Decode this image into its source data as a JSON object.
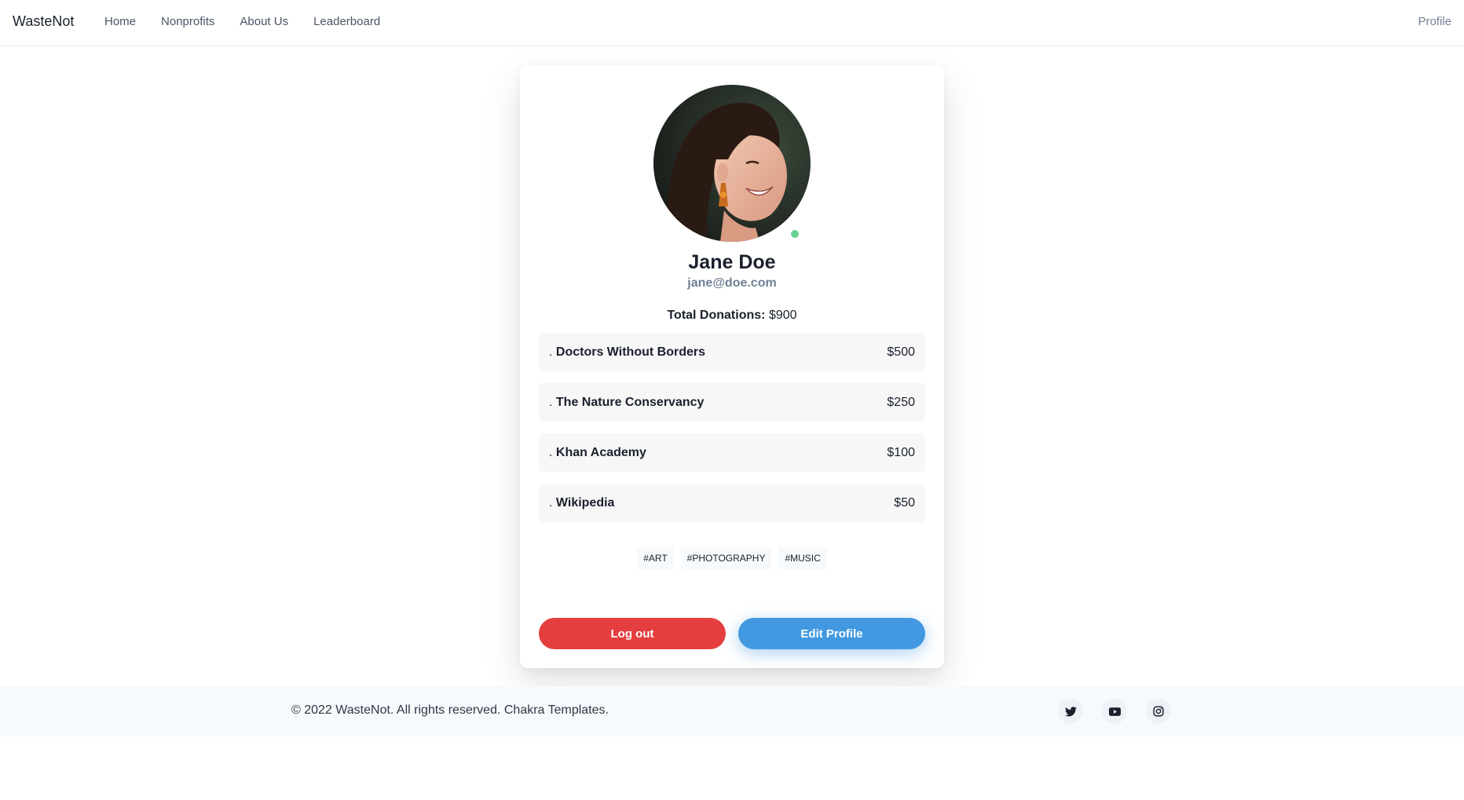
{
  "navbar": {
    "brand": "WasteNot",
    "links": [
      "Home",
      "Nonprofits",
      "About Us",
      "Leaderboard"
    ],
    "profile": "Profile"
  },
  "profile": {
    "name": "Jane Doe",
    "email": "jane@doe.com",
    "total_label": "Total Donations:",
    "total_value": "$900",
    "status": "online",
    "status_color": "#68d391",
    "donations": [
      {
        "prefix": ".",
        "name": "Doctors Without Borders",
        "amount": "$500"
      },
      {
        "prefix": ".",
        "name": "The Nature Conservancy",
        "amount": "$250"
      },
      {
        "prefix": ".",
        "name": "Khan Academy",
        "amount": "$100"
      },
      {
        "prefix": ".",
        "name": "Wikipedia",
        "amount": "$50"
      }
    ],
    "tags": [
      "#art",
      "#photography",
      "#music"
    ],
    "logout_label": "Log out",
    "edit_label": "Edit Profile"
  },
  "colors": {
    "logout": "#e53e3e",
    "edit": "#4299e1"
  },
  "footer": {
    "copyright": "© 2022 WasteNot. All rights reserved. Chakra Templates.",
    "socials": [
      "twitter-icon",
      "youtube-icon",
      "instagram-icon"
    ]
  }
}
